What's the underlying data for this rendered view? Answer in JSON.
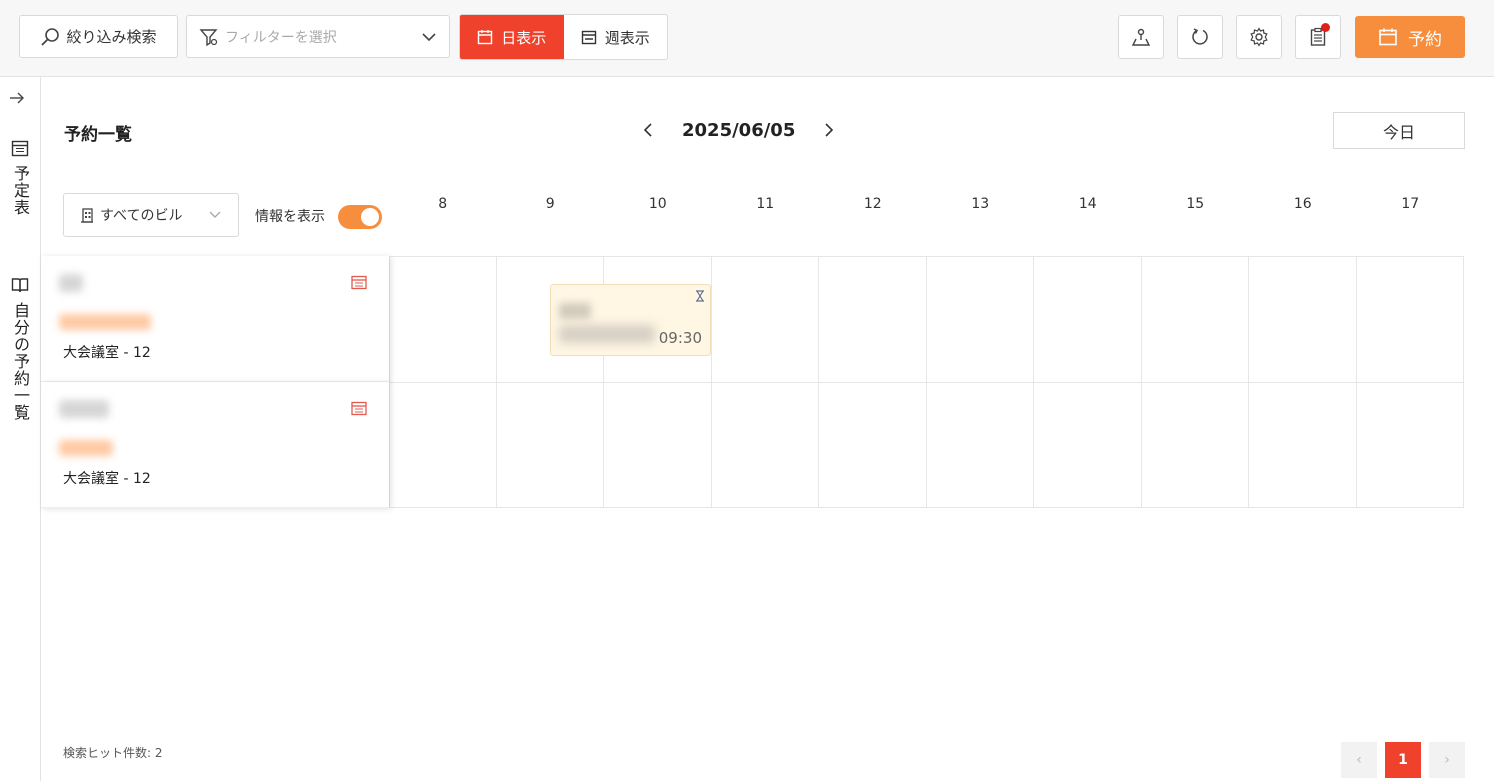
{
  "toolbar": {
    "search_label": "絞り込み検索",
    "filter_placeholder": "フィルターを選択",
    "day_view_label": "日表示",
    "week_view_label": "週表示",
    "reserve_label": "予約"
  },
  "sidebar": {
    "items": [
      {
        "label": "予定表"
      },
      {
        "label": "自分の予約一覧"
      }
    ]
  },
  "main": {
    "title": "予約一覧",
    "date": "2025/06/05",
    "today_label": "今日",
    "building_select": "すべてのビル",
    "info_toggle_label": "情報を表示",
    "info_toggle_on": true,
    "hours": [
      "8",
      "9",
      "10",
      "11",
      "12",
      "13",
      "14",
      "15",
      "16",
      "17"
    ],
    "rooms": [
      {
        "name": "大会議室 - 12"
      },
      {
        "name": "大会議室 - 12"
      }
    ],
    "event": {
      "time": "09:30",
      "status": "pending"
    }
  },
  "footer": {
    "hit_count": "検索ヒット件数: 2",
    "current_page": "1",
    "prev_label": "‹",
    "next_label": "›"
  },
  "colors": {
    "accent_red": "#f0412d",
    "accent_orange": "#f78e3d",
    "event_bg": "#fff6e3"
  },
  "icons": {
    "search": "search-icon",
    "filter": "filter-icon",
    "chevron": "chevron-down-icon",
    "day": "calendar-day-icon",
    "week": "calendar-week-icon",
    "map": "map-pin-icon",
    "refresh": "refresh-icon",
    "settings": "gear-icon",
    "clipboard": "clipboard-icon",
    "reserve": "calendar-plus-icon"
  }
}
